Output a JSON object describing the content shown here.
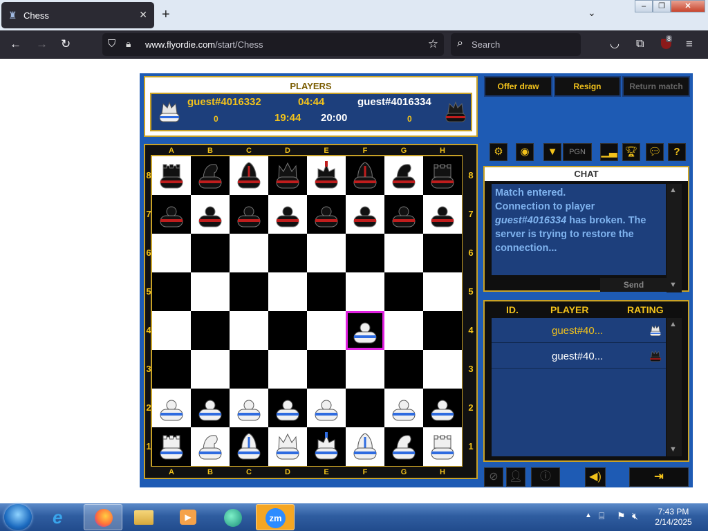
{
  "browser": {
    "tab_title": "Chess",
    "url_domain": "www.flyordie.com",
    "url_path": "/start/Chess",
    "search_placeholder": "Search",
    "ublock_count": "8"
  },
  "game": {
    "players_title": "PLAYERS",
    "player1": {
      "name": "guest#4016332",
      "score": "0",
      "time": "04:44",
      "color": "white"
    },
    "player2": {
      "name": "guest#4016334",
      "score": "0",
      "color": "red"
    },
    "time_remaining": "19:44",
    "time_total": "20:00",
    "buttons": {
      "offer_draw": "Offer draw",
      "resign": "Resign",
      "return_match": "Return match",
      "pgn": "PGN"
    },
    "chat": {
      "title": "CHAT",
      "msg_line1": "Match entered.",
      "msg_line2a": "Connection to player ",
      "msg_player": "guest#4016334",
      "msg_line2b": " has broken. The server is trying to restore the connection...",
      "send": "Send"
    },
    "player_list": {
      "col_id": "ID.",
      "col_player": "PLAYER",
      "col_rating": "RATING",
      "rows": [
        {
          "name": "guest#40...",
          "color": "white"
        },
        {
          "name": "guest#40...",
          "color": "red"
        }
      ]
    },
    "files": [
      "A",
      "B",
      "C",
      "D",
      "E",
      "F",
      "G",
      "H"
    ],
    "ranks": [
      "8",
      "7",
      "6",
      "5",
      "4",
      "3",
      "2",
      "1"
    ],
    "position": [
      [
        "r",
        "n",
        "b",
        "q",
        "k",
        "b",
        "n",
        "r"
      ],
      [
        "p",
        "p",
        "p",
        "p",
        "p",
        "p",
        "p",
        "p"
      ],
      [
        "",
        "",
        "",
        "",
        "",
        "",
        "",
        ""
      ],
      [
        "",
        "",
        "",
        "",
        "",
        "",
        "",
        ""
      ],
      [
        "",
        "",
        "",
        "",
        "",
        "P",
        "",
        ""
      ],
      [
        "",
        "",
        "",
        "",
        "",
        "",
        "",
        ""
      ],
      [
        "P",
        "P",
        "P",
        "P",
        "P",
        "",
        "P",
        "P"
      ],
      [
        "R",
        "N",
        "B",
        "Q",
        "K",
        "B",
        "N",
        "R"
      ]
    ],
    "highlight": "F4"
  },
  "colors": {
    "accent_gold": "#f2c21b",
    "frame_blue": "#1e5bb4",
    "highlight": "#e020e0"
  },
  "taskbar": {
    "time": "7:43 PM",
    "date": "2/14/2025"
  }
}
